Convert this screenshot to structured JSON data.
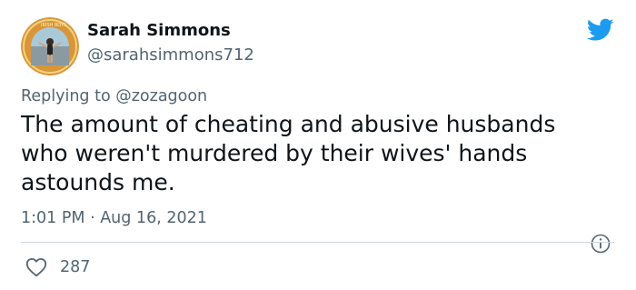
{
  "author": {
    "name": "Sarah Simmons",
    "handle": "@sarahsimmons712"
  },
  "reply": {
    "prefix": "Replying to ",
    "mention": "@zozagoon"
  },
  "tweet": {
    "lines": [
      "The amount of cheating and abusive husbands",
      "who weren't murdered by their wives' hands",
      "astounds me."
    ],
    "timestamp": "1:01 PM · Aug 16, 2021"
  },
  "stats": {
    "likes": "287"
  },
  "icons": {
    "brand": "twitter-bird-icon",
    "info": "info-icon",
    "like": "heart-icon"
  },
  "colors": {
    "brand": "#1d9bf0",
    "secondary_text": "#536471",
    "primary_text": "#0f1419",
    "divider": "#cfd9de"
  }
}
